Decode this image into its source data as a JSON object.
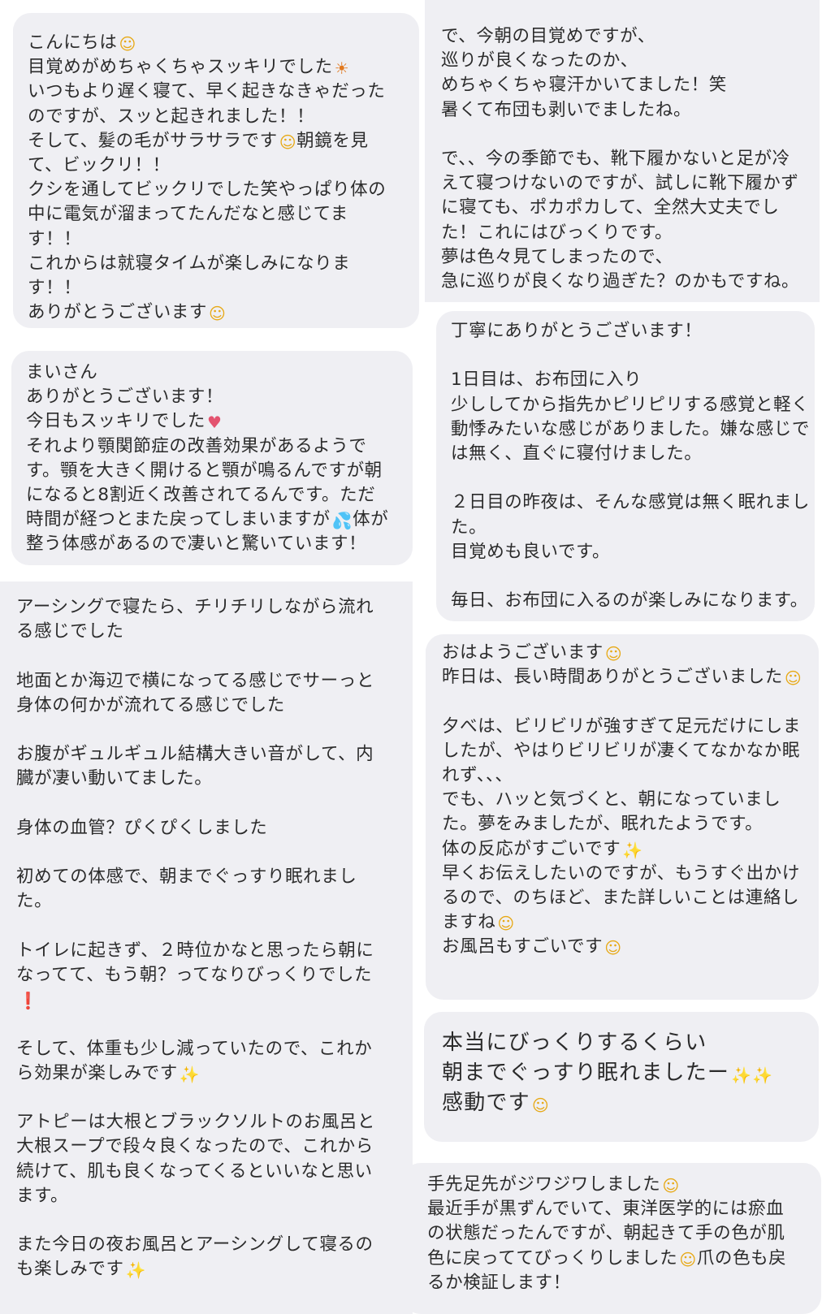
{
  "msg1": {
    "lines": [
      {
        "text": "こんにちは",
        "emoji": "☺"
      },
      {
        "text": "目覚めがめちゃくちゃスッキリでした",
        "emoji": "☀"
      },
      {
        "text": "いつもより遅く寝て、早く起きなきゃだった"
      },
      {
        "text": "のですが、スッと起きれました！！"
      },
      {
        "text": "そして、髪の毛がサラサラです",
        "emoji": "☺",
        "after": "朝鏡を見"
      },
      {
        "text": "て、ビックリ！！"
      },
      {
        "text": "クシを通してビックリでした笑やっぱり体の"
      },
      {
        "text": "中に電気が溜まってたんだなと感じてま"
      },
      {
        "text": "す！！"
      },
      {
        "text": "これからは就寝タイムが楽しみになりま"
      },
      {
        "text": "す！！"
      },
      {
        "text": "ありがとうございます",
        "emoji": "☺"
      }
    ]
  },
  "msg2": {
    "lines": [
      {
        "text": "で、今朝の目覚めですが、"
      },
      {
        "text": "巡りが良くなったのか、"
      },
      {
        "text": "めちゃくちゃ寝汗かいてました！笑"
      },
      {
        "text": "暑くて布団も剥いでましたね。"
      },
      {
        "text": ""
      },
      {
        "text": "で、、今の季節でも、靴下履かないと足が冷"
      },
      {
        "text": "えて寝つけないのですが、試しに靴下履かず"
      },
      {
        "text": "に寝ても、ポカポカして、全然大丈夫でし"
      },
      {
        "text": "た！これにはびっくりです。"
      },
      {
        "text": "夢は色々見てしまったので、"
      },
      {
        "text": "急に巡りが良くなり過ぎた？のかもですね。"
      }
    ]
  },
  "msg3": {
    "lines": [
      {
        "text": "まいさん"
      },
      {
        "text": "ありがとうございます！"
      },
      {
        "text": "今日もスッキリでした",
        "emoji": "♥"
      },
      {
        "text": "それより顎関節症の改善効果があるようで"
      },
      {
        "text": "す。顎を大きく開けると顎が鳴るんですが朝"
      },
      {
        "text": "になると8割近く改善されてるんです。ただ"
      },
      {
        "text": "時間が経つとまた戻ってしまいますが",
        "emoji": "💦",
        "after": "体が"
      },
      {
        "text": "整う体感があるので凄いと驚いています！"
      }
    ]
  },
  "msg4": {
    "lines": [
      {
        "text": "丁寧にありがとうございます！"
      },
      {
        "text": ""
      },
      {
        "text": "1日目は、お布団に入り"
      },
      {
        "text": "少ししてから指先かピリピリする感覚と軽く"
      },
      {
        "text": "動悸みたいな感じがありました。嫌な感じで"
      },
      {
        "text": "は無く、直ぐに寝付けました。"
      },
      {
        "text": ""
      },
      {
        "text": "２日目の昨夜は、そんな感覚は無く眠れまし"
      },
      {
        "text": "た。"
      },
      {
        "text": "目覚めも良いです。"
      },
      {
        "text": ""
      },
      {
        "text": "毎日、お布団に入るのが楽しみになります。"
      }
    ]
  },
  "msg5": {
    "lines": [
      {
        "text": "アーシングで寝たら、チリチリしながら流れ"
      },
      {
        "text": "る感じでした"
      },
      {
        "text": ""
      },
      {
        "text": "地面とか海辺で横になってる感じでサーっと"
      },
      {
        "text": "身体の何かが流れてる感じでした"
      },
      {
        "text": ""
      },
      {
        "text": "お腹がギュルギュル結構大きい音がして、内"
      },
      {
        "text": "臓が凄い動いてました。"
      },
      {
        "text": ""
      },
      {
        "text": "身体の血管？ぴくぴくしました"
      },
      {
        "text": ""
      },
      {
        "text": "初めての体感で、朝までぐっすり眠れまし"
      },
      {
        "text": "た。"
      },
      {
        "text": ""
      },
      {
        "text": "トイレに起きず、２時位かなと思ったら朝に"
      },
      {
        "text": "なってて、もう朝？ってなりびっくりでした"
      },
      {
        "text": "",
        "emoji": "❗"
      },
      {
        "text": ""
      },
      {
        "text": "そして、体重も少し減っていたので、これか"
      },
      {
        "text": "ら効果が楽しみです",
        "emoji": "✨"
      },
      {
        "text": ""
      },
      {
        "text": "アトピーは大根とブラックソルトのお風呂と"
      },
      {
        "text": "大根スープで段々良くなったので、これから"
      },
      {
        "text": "続けて、肌も良くなってくるといいなと思い"
      },
      {
        "text": "ます。"
      },
      {
        "text": ""
      },
      {
        "text": "また今日の夜お風呂とアーシングして寝るの"
      },
      {
        "text": "も楽しみです",
        "emoji": "✨"
      }
    ]
  },
  "msg6": {
    "lines": [
      {
        "text": "おはようございます",
        "emoji": "☺"
      },
      {
        "text": "昨日は、長い時間ありがとうございました",
        "emoji": "☺"
      },
      {
        "text": ""
      },
      {
        "text": "夕べは、ビリビリが強すぎて足元だけにしま"
      },
      {
        "text": "したが、やはりビリビリが凄くてなかなか眠"
      },
      {
        "text": "れず、、、"
      },
      {
        "text": "でも、ハッと気づくと、朝になっていまし"
      },
      {
        "text": "た。夢をみましたが、眠れたようです。"
      },
      {
        "text": "体の反応がすごいです",
        "emoji": "✨"
      },
      {
        "text": "早くお伝えしたいのですが、もうすぐ出かけ"
      },
      {
        "text": "るので、のちほど、また詳しいことは連絡し"
      },
      {
        "text": "ますね",
        "emoji": "☺"
      },
      {
        "text": "お風呂もすごいです",
        "emoji": "☺"
      }
    ]
  },
  "msg7": {
    "lines": [
      {
        "text": "本当にびっくりするくらい"
      },
      {
        "text": "朝までぐっすり眠れましたー",
        "emoji": "✨✨"
      },
      {
        "text": "感動です",
        "emoji": "☺"
      }
    ]
  },
  "msg8": {
    "lines": [
      {
        "text": "手先足先がジワジワしました",
        "emoji": "☺"
      },
      {
        "text": "最近手が黒ずんでいて、東洋医学的には瘀血"
      },
      {
        "text": "の状態だったんですが、朝起きて手の色が肌"
      },
      {
        "text": "色に戻っててびっくりしました",
        "emoji": "☺",
        "after": "爪の色も戻"
      },
      {
        "text": "るか検証します！"
      }
    ]
  }
}
